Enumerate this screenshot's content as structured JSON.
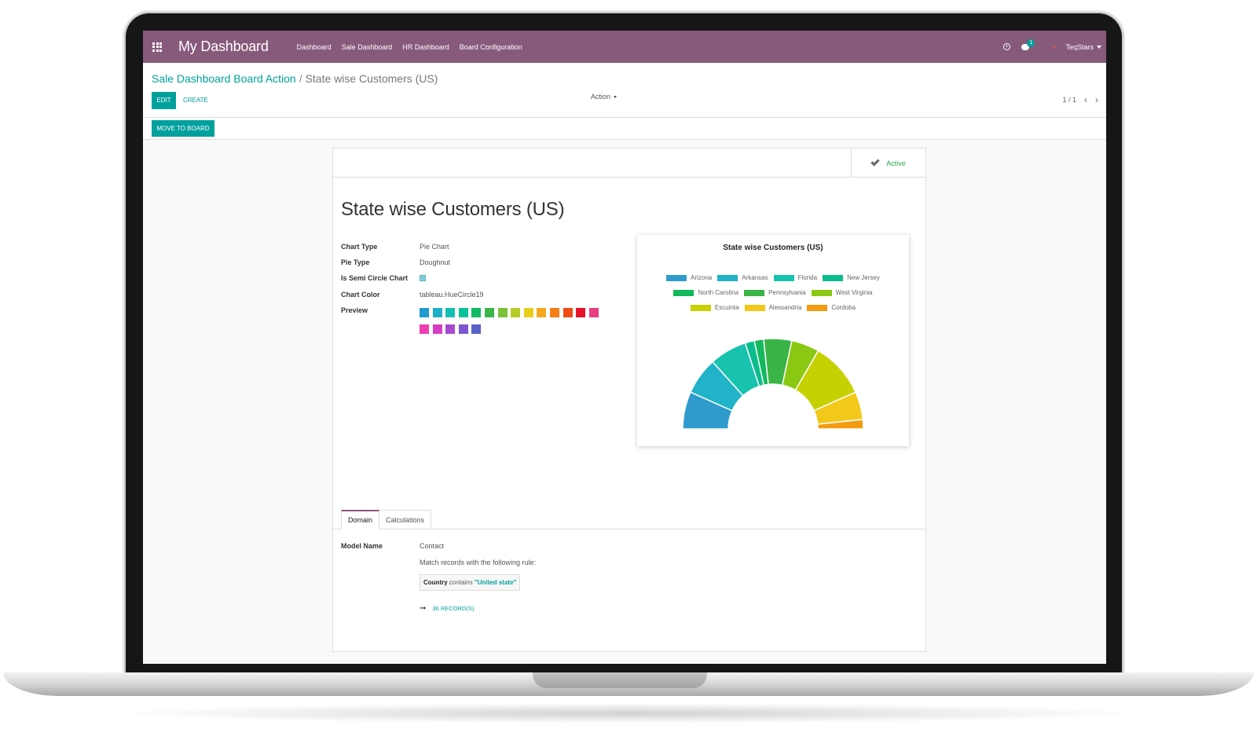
{
  "navbar": {
    "brand": "My Dashboard",
    "menu": [
      "Dashboard",
      "Sale Dashboard",
      "HR Dashboard",
      "Board Configuration"
    ],
    "chat_badge": "1",
    "user": "TeqStars"
  },
  "control_panel": {
    "breadcrumb_parent": "Sale Dashboard Board Action",
    "breadcrumb_separator": "/",
    "breadcrumb_current": "State wise Customers (US)",
    "edit_label": "EDIT",
    "create_label": "CREATE",
    "action_label": "Action",
    "pager": "1 / 1",
    "prev_icon": "chevron-left-icon",
    "next_icon": "chevron-right-icon"
  },
  "button_bar": {
    "move_to_board_label": "MOVE TO BOARD"
  },
  "form": {
    "status_label": "Active",
    "title": "State wise Customers (US)",
    "fields": {
      "chart_type_label": "Chart Type",
      "chart_type_value": "Pie Chart",
      "pie_type_label": "Pie Type",
      "pie_type_value": "Doughnut",
      "semi_circle_label": "Is Semi Circle Chart",
      "semi_circle_checked": true,
      "chart_color_label": "Chart Color",
      "chart_color_value": "tableau.HueCircle19",
      "preview_label": "Preview"
    },
    "palette": [
      "#1f9ad0",
      "#1fb0c8",
      "#13bfb3",
      "#09c29b",
      "#0fba62",
      "#3ab54a",
      "#7cc23a",
      "#b6cd26",
      "#e8cd1b",
      "#f7a71e",
      "#f67e19",
      "#ee4c15",
      "#e8132a",
      "#ec3e82",
      "#ee40b2",
      "#d43dc4",
      "#a74ad0",
      "#7d56cf",
      "#5a62c8"
    ],
    "tabs": [
      "Domain",
      "Calculations"
    ],
    "domain": {
      "model_label": "Model Name",
      "model_value": "Contact",
      "rule_text": "Match records with the following rule:",
      "rule_field": "Country",
      "rule_operator": "contains",
      "rule_value": "\"United state\"",
      "records_link": "36 RECORD(S)"
    }
  },
  "chart_data": {
    "type": "pie",
    "subtype": "doughnut-semicircle",
    "title": "State wise Customers (US)",
    "legend_position": "top",
    "categories": [
      "Arizona",
      "Arkansas",
      "Florida",
      "New Jersey",
      "North Carolina",
      "Pennsylvania",
      "West Virginia",
      "Escuinta",
      "Alessandria",
      "Cordoba"
    ],
    "values": [
      4,
      4,
      4,
      1,
      1,
      3,
      3,
      6,
      3,
      1
    ],
    "colors": [
      "#2e9bcc",
      "#21b3c7",
      "#17c2ae",
      "#0bbd8c",
      "#13b95c",
      "#3bb447",
      "#8ac813",
      "#c7d000",
      "#f2c81a",
      "#f39c12"
    ]
  }
}
